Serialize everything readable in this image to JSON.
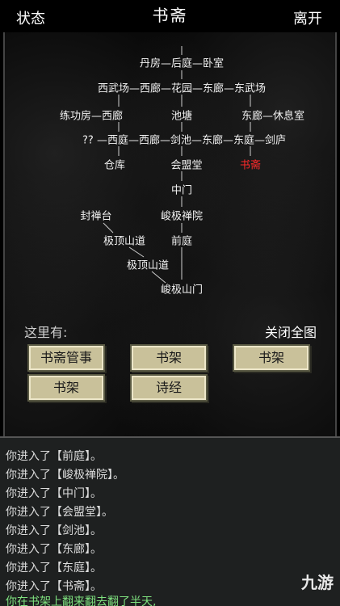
{
  "header": {
    "status_label": "状态",
    "title": "书斋",
    "leave_label": "离开"
  },
  "map": {
    "nodes": [
      {
        "id": "danfang",
        "text": "丹房—后庭—卧室"
      },
      {
        "id": "row2",
        "text": "西武场—西廊—花园—东廊—东武场"
      },
      {
        "id": "lianggong",
        "text": "练功房—西廊"
      },
      {
        "id": "chitang",
        "text": "池塘"
      },
      {
        "id": "xiuxi",
        "text": "东廊—休息室"
      },
      {
        "id": "row4",
        "text": "?? —西庭—西廊—剑池—东廊—东庭—剑庐"
      },
      {
        "id": "cangku",
        "text": "仓库"
      },
      {
        "id": "huimeng",
        "text": "会盟堂"
      },
      {
        "id": "shuzhai",
        "text": "书斋"
      },
      {
        "id": "zhongmen",
        "text": "中门"
      },
      {
        "id": "fengchan",
        "text": "封禅台"
      },
      {
        "id": "junji",
        "text": "峻极禅院"
      },
      {
        "id": "jiding1",
        "text": "极顶山道"
      },
      {
        "id": "qianting",
        "text": "前庭"
      },
      {
        "id": "jiding2",
        "text": "极顶山道"
      },
      {
        "id": "shanmen",
        "text": "峻极山门"
      }
    ],
    "current_color": "#ff2a2a"
  },
  "here": {
    "label": "这里有:",
    "close_label": "关闭全图"
  },
  "objects": [
    "书斋管事",
    "书架",
    "书架",
    "书架",
    "诗经"
  ],
  "log": [
    "你进入了【前庭】。",
    "你进入了【峻极禅院】。",
    "你进入了【中门】。",
    "你进入了【会盟堂】。",
    "你进入了【剑池】。",
    "你进入了【东廊】。",
    "你进入了【东庭】。",
    "你进入了【书斋】。",
    "你在书架上翻来翻去翻了半天,"
  ],
  "watermark": "九游"
}
